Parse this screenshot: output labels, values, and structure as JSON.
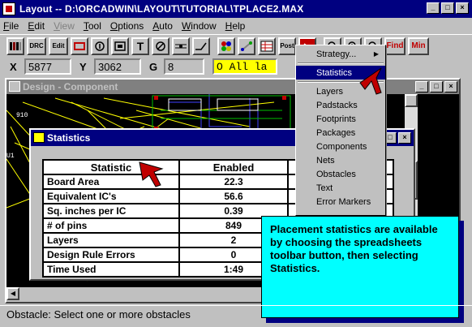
{
  "window": {
    "title": "Layout -- D:\\ORCADWIN\\LAYOUT\\TUTORIAL\\TPLACE2.MAX"
  },
  "menubar": [
    "File",
    "Edit",
    "View",
    "Tool",
    "Options",
    "Auto",
    "Window",
    "Help"
  ],
  "menubar_disabled": [
    "View"
  ],
  "toolbar": {
    "buttons": [
      "DRC",
      "Edit",
      "Post",
      "Find",
      "Min"
    ]
  },
  "coordinates": {
    "x_label": "X",
    "x_value": "5877",
    "y_label": "Y",
    "y_value": "3062",
    "g_label": "G",
    "g_value": "8",
    "status": "O All la"
  },
  "design_window": {
    "title": "Design - Component"
  },
  "stats_window": {
    "title": "Statistics",
    "headers": [
      "Statistic",
      "Enabled"
    ],
    "rows": [
      {
        "label": "Board Area",
        "value": "22.3"
      },
      {
        "label": "Equivalent IC's",
        "value": "56.6"
      },
      {
        "label": "Sq. inches per IC",
        "value": "0.39"
      },
      {
        "label": "# of pins",
        "value": "849"
      },
      {
        "label": "Layers",
        "value": "2"
      },
      {
        "label": "Design Rule Errors",
        "value": "0"
      },
      {
        "label": "Time Used",
        "value": "1:49"
      }
    ]
  },
  "dropdown": {
    "items": [
      "Strategy...",
      "Statistics",
      "Layers",
      "Padstacks",
      "Footprints",
      "Packages",
      "Components",
      "Nets",
      "Obstacles",
      "Text",
      "Error Markers"
    ],
    "selected": "Statistics"
  },
  "callout": {
    "text": "Placement statistics are available by choosing the spreadsheets toolbar button, then selecting Statistics."
  },
  "statusbar": {
    "text": "Obstacle: Select one or more obstacles"
  },
  "colors": {
    "title_active": "#000080",
    "title_inactive": "#808080",
    "callout_bg": "#00ffff",
    "status_field": "#ffff00"
  }
}
